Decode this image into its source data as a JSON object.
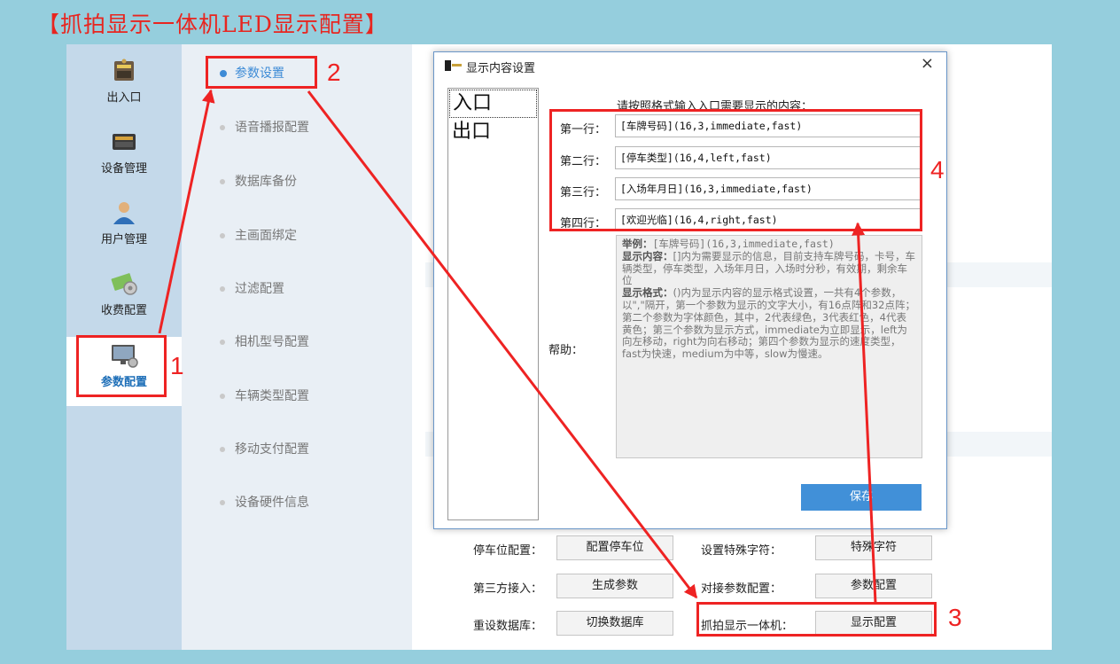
{
  "page_title": "【抓拍显示一体机LED显示配置】",
  "colors": {
    "annotation": "#ee2323",
    "accent": "#3d8bd6",
    "save_button": "#4190d8",
    "background": "#95cedd"
  },
  "leftnav": {
    "items": [
      {
        "label": "出入口",
        "icon": "gate-icon"
      },
      {
        "label": "设备管理",
        "icon": "device-icon"
      },
      {
        "label": "用户管理",
        "icon": "user-icon"
      },
      {
        "label": "收费配置",
        "icon": "money-icon"
      },
      {
        "label": "参数配置",
        "icon": "monitor-gear-icon",
        "active": true
      }
    ]
  },
  "subnav": {
    "items": [
      {
        "label": "参数设置",
        "active": true
      },
      {
        "label": "语音播报配置"
      },
      {
        "label": "数据库备份"
      },
      {
        "label": "主画面绑定"
      },
      {
        "label": "过滤配置"
      },
      {
        "label": "相机型号配置"
      },
      {
        "label": "车辆类型配置"
      },
      {
        "label": "移动支付配置"
      },
      {
        "label": "设备硬件信息"
      }
    ]
  },
  "form": {
    "parking_label": "停车位配置：",
    "parking_btn": "配置停车位",
    "special_label": "设置特殊字符：",
    "special_btn": "特殊字符",
    "third_label": "第三方接入：",
    "third_btn": "生成参数",
    "dock_label": "对接参数配置：",
    "dock_btn": "参数配置",
    "reset_label": "重设数据库：",
    "reset_btn": "切换数据库",
    "capture_label": "抓拍显示一体机：",
    "capture_btn": "显示配置"
  },
  "dialog": {
    "title": "显示内容设置",
    "close": "×",
    "list": [
      "入口",
      "出口"
    ],
    "instruction": "请按照格式输入入口需要显示的内容：",
    "rows": [
      {
        "label": "第一行：",
        "value": "[车牌号码](16,3,immediate,fast)"
      },
      {
        "label": "第二行：",
        "value": "[停车类型](16,4,left,fast)"
      },
      {
        "label": "第三行：",
        "value": "[入场年月日](16,3,immediate,fast)"
      },
      {
        "label": "第四行：",
        "value": "[欢迎光临](16,4,right,fast)"
      }
    ],
    "help_label": "帮助：",
    "help": {
      "example_title": "举例：",
      "example": "[车牌号码](16,3,immediate,fast)",
      "content_title": "显示内容：",
      "content": "[]内为需要显示的信息，目前支持车牌号码，卡号，车辆类型，停车类型，入场年月日，入场时分秒，有效期，剩余车位",
      "format_title": "显示格式：",
      "format": "()内为显示内容的显示格式设置，一共有4个参数，以\",\"隔开，第一个参数为显示的文字大小，有16点阵和32点阵；第二个参数为字体颜色，其中，2代表绿色，3代表红色，4代表黄色；第三个参数为显示方式，immediate为立即显示，left为向左移动，right为向右移动；第四个参数为显示的速度类型，fast为快速，medium为中等，slow为慢速。"
    },
    "save": "保存"
  },
  "annotations": [
    "1",
    "2",
    "3",
    "4"
  ]
}
